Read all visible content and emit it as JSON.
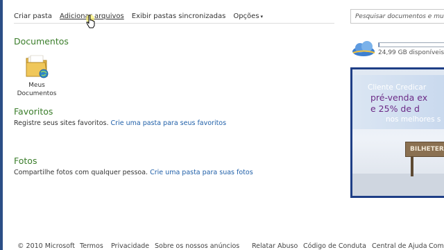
{
  "toolbar": {
    "create_folder": "Criar pasta",
    "add_files": "Adicionar arquivos",
    "show_synced": "Exibir pastas sincronizadas",
    "options": "Opções",
    "options_arrow": "▾"
  },
  "search": {
    "placeholder": "Pesquisar documentos e muito"
  },
  "documents": {
    "title": "Documentos",
    "folder_label_line1": "Meus",
    "folder_label_line2": "Documentos"
  },
  "favorites": {
    "title": "Favoritos",
    "description": "Registre seus sites favoritos.",
    "link": "Crie uma pasta para seus favoritos"
  },
  "photos": {
    "title": "Fotos",
    "description": "Compartilhe fotos com qualquer pessoa.",
    "link": "Crie uma pasta para suas fotos"
  },
  "storage": {
    "text": "24,99 GB disponíveis d",
    "used_fraction": 0.01
  },
  "ad": {
    "line1": "Cliente Credicar",
    "line2": "pré-venda ex",
    "line3": "e 25% de d",
    "line4": "nos melhores s",
    "ticket": "BILHETER"
  },
  "footer": {
    "copyright": "© 2010 Microsoft",
    "terms": "Termos",
    "privacy": "Privacidade",
    "about_ads": "Sobre os nossos anúncios",
    "report_abuse": "Relatar Abuso",
    "code_of_conduct": "Código de Conduta",
    "help_center": "Central de Ajuda",
    "comments": "Comen"
  },
  "colors": {
    "section_title": "#3a7d2a",
    "link": "#1f5fa8",
    "ad_frame": "#1e3e86",
    "ad_purple": "#6b2a86"
  },
  "icons": {
    "folder": "folder-with-globe-icon",
    "storage": "skydrive-cloud-icon",
    "cursor": "hand-pointer-icon"
  }
}
